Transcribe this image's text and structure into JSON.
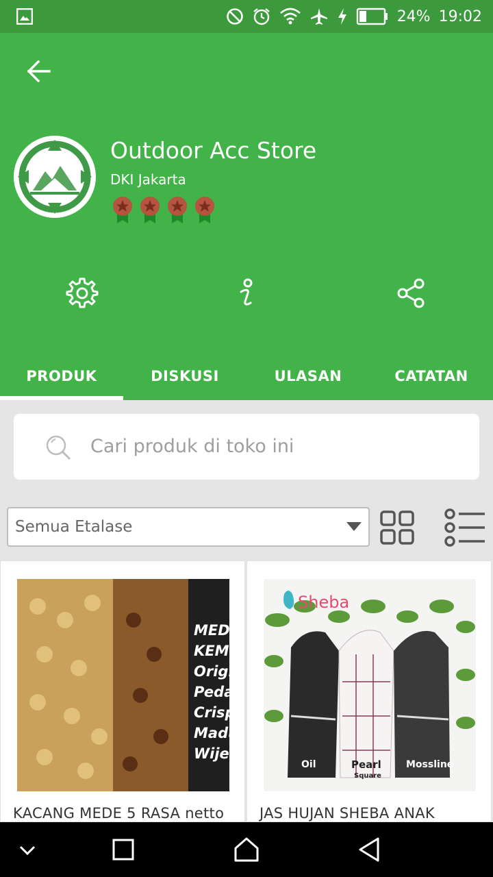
{
  "status_bar": {
    "battery": "24%",
    "time": "19:02",
    "icons": [
      "image-icon",
      "do-not-disturb-icon",
      "alarm-icon",
      "wifi-icon",
      "airplane-icon",
      "charging-icon",
      "battery-icon"
    ]
  },
  "shop": {
    "name": "Outdoor Acc Store",
    "location": "DKI Jakarta",
    "medal_count": 4
  },
  "actions": [
    "settings-icon",
    "info-icon",
    "share-icon"
  ],
  "tabs": [
    {
      "label": "PRODUK",
      "active": true
    },
    {
      "label": "DISKUSI",
      "active": false
    },
    {
      "label": "ULASAN",
      "active": false
    },
    {
      "label": "CATATAN",
      "active": false
    }
  ],
  "search": {
    "placeholder": "Cari produk di toko ini"
  },
  "etalase": {
    "selected": "Semua Etalase"
  },
  "products": [
    {
      "name": "KACANG MEDE 5 RASA netto",
      "image_lines": [
        "MED",
        "KEM",
        "Origi",
        "Peda",
        "Crisp",
        "Madu",
        "Wije"
      ]
    },
    {
      "name": "JAS HUJAN SHEBA ANAK",
      "brand": "Sheba",
      "labels": [
        "Oil",
        "Pearl",
        "Square",
        "Mossline"
      ]
    }
  ],
  "colors": {
    "primary": "#42b349",
    "status_bar": "#3c9a3c",
    "medal": "#b5543f"
  }
}
